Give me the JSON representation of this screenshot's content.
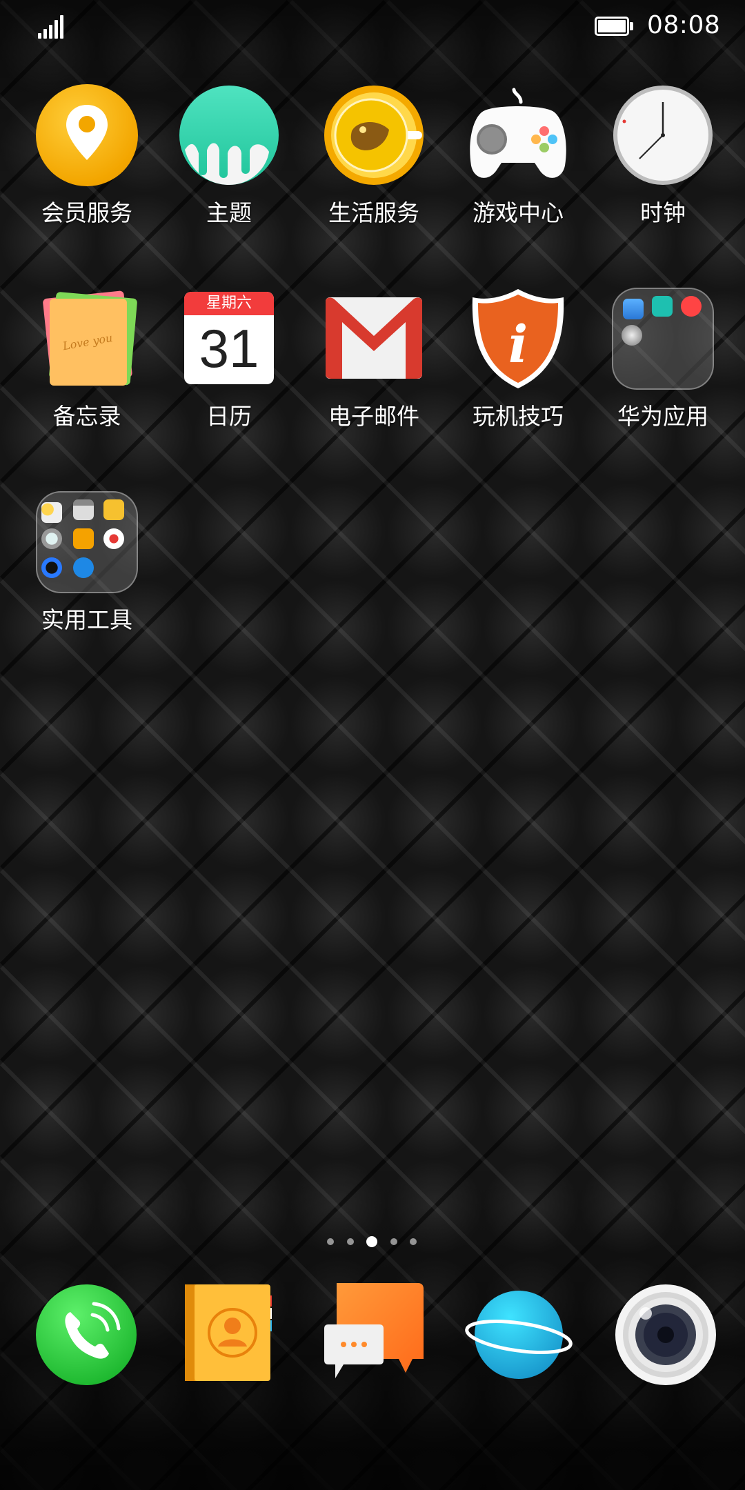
{
  "status_bar": {
    "time": "08:08",
    "signal_icon": "signal-icon",
    "battery_icon": "battery-icon"
  },
  "apps": [
    {
      "label": "会员服务",
      "icon": "location-pin-icon"
    },
    {
      "label": "主题",
      "icon": "theme-icon"
    },
    {
      "label": "生活服务",
      "icon": "life-service-icon"
    },
    {
      "label": "游戏中心",
      "icon": "gamepad-icon"
    },
    {
      "label": "时钟",
      "icon": "clock-icon"
    },
    {
      "label": "备忘录",
      "icon": "notepad-icon"
    },
    {
      "label": "日历",
      "icon": "calendar-icon",
      "weekday": "星期六",
      "day": "31"
    },
    {
      "label": "电子邮件",
      "icon": "mail-icon"
    },
    {
      "label": "玩机技巧",
      "icon": "tips-shield-icon"
    },
    {
      "label": "华为应用",
      "icon": "folder-icon"
    },
    {
      "label": "实用工具",
      "icon": "folder-icon"
    }
  ],
  "memo_text": "Love you",
  "page_indicator": {
    "count": 5,
    "active": 3
  },
  "dock": [
    {
      "name": "phone",
      "icon": "phone-icon"
    },
    {
      "name": "contacts",
      "icon": "contacts-icon"
    },
    {
      "name": "messages",
      "icon": "messages-icon"
    },
    {
      "name": "browser",
      "icon": "planet-icon"
    },
    {
      "name": "camera",
      "icon": "camera-icon"
    }
  ],
  "colors": {
    "accent_orange": "#f5a200",
    "teal": "#2fd8b0",
    "mail_red": "#d32f2f",
    "phone_green": "#2ecc40"
  }
}
